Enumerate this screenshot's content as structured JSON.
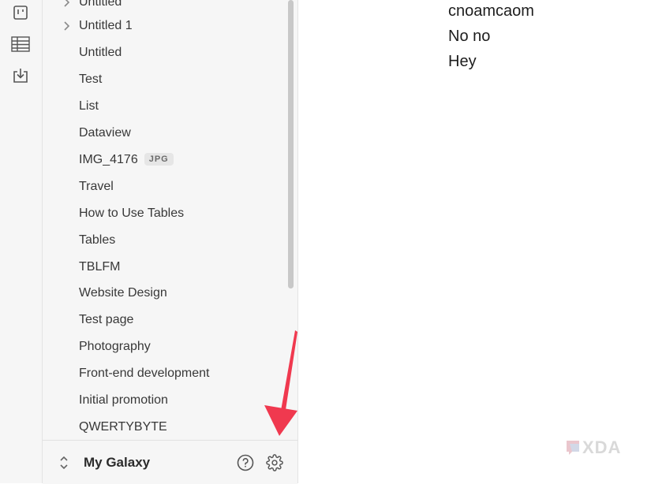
{
  "sidebar": {
    "items": [
      {
        "label": "Untitled",
        "has_children": true,
        "tag": ""
      },
      {
        "label": "Untitled 1",
        "has_children": true,
        "tag": ""
      },
      {
        "label": "Untitled",
        "has_children": false,
        "tag": ""
      },
      {
        "label": "Test",
        "has_children": false,
        "tag": ""
      },
      {
        "label": "List",
        "has_children": false,
        "tag": ""
      },
      {
        "label": "Dataview",
        "has_children": false,
        "tag": ""
      },
      {
        "label": "IMG_4176",
        "has_children": false,
        "tag": "JPG"
      },
      {
        "label": "Travel",
        "has_children": false,
        "tag": ""
      },
      {
        "label": "How to Use Tables",
        "has_children": false,
        "tag": ""
      },
      {
        "label": "Tables",
        "has_children": false,
        "tag": ""
      },
      {
        "label": "TBLFM",
        "has_children": false,
        "tag": ""
      },
      {
        "label": "Website Design",
        "has_children": false,
        "tag": ""
      },
      {
        "label": "Test page",
        "has_children": false,
        "tag": ""
      },
      {
        "label": "Photography",
        "has_children": false,
        "tag": ""
      },
      {
        "label": "Front-end development",
        "has_children": false,
        "tag": ""
      },
      {
        "label": "Initial promotion",
        "has_children": false,
        "tag": ""
      },
      {
        "label": "QWERTYBYTE",
        "has_children": false,
        "tag": ""
      }
    ]
  },
  "ribbon": {
    "icons": [
      "kanban-board-icon",
      "table-icon",
      "import-icon"
    ]
  },
  "vault": {
    "name": "My Galaxy",
    "icons": [
      "vault-switcher-icon",
      "help-icon",
      "settings-icon"
    ]
  },
  "content": {
    "lines": [
      "cnoamcaom",
      "No no",
      "Hey"
    ]
  },
  "annotation": {
    "arrow_color": "#f0394f"
  },
  "watermark": {
    "text": "XDA",
    "colors": [
      "#e8c0c8",
      "#cfd9ea"
    ]
  }
}
